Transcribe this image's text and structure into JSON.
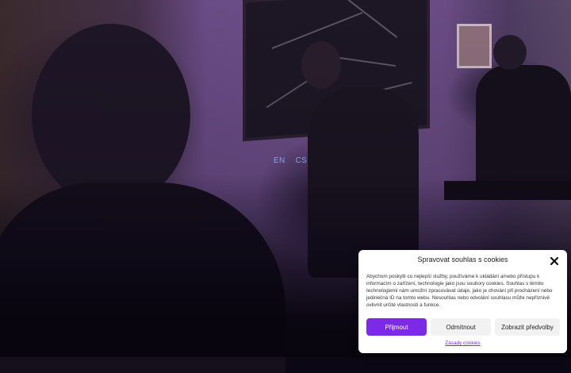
{
  "language_switcher": {
    "items": [
      {
        "label": "EN"
      },
      {
        "label": "CS"
      }
    ],
    "link_color": "#7ea3ef"
  },
  "cookie_banner": {
    "title": "Spravovat souhlas s cookies",
    "text": "Abychom poskytli co nejlepší služby, používáme k ukládání a/nebo přístupu k informacím o zařízení, technologie jako jsou soubory cookies. Souhlas s těmito technologiemi nám umožní zpracovávat údaje, jako je chování při procházení nebo jedinečná ID na tomto webu. Nesouhlas nebo odvolání souhlasu může nepříznivě ovlivnit určité vlastnosti a funkce.",
    "accept_label": "Přijmout",
    "deny_label": "Odmítnout",
    "preferences_label": "Zobrazit předvolby",
    "policy_link": "Zásady cookies",
    "accent_color": "#7d2ae8",
    "close_icon": "close-icon"
  }
}
